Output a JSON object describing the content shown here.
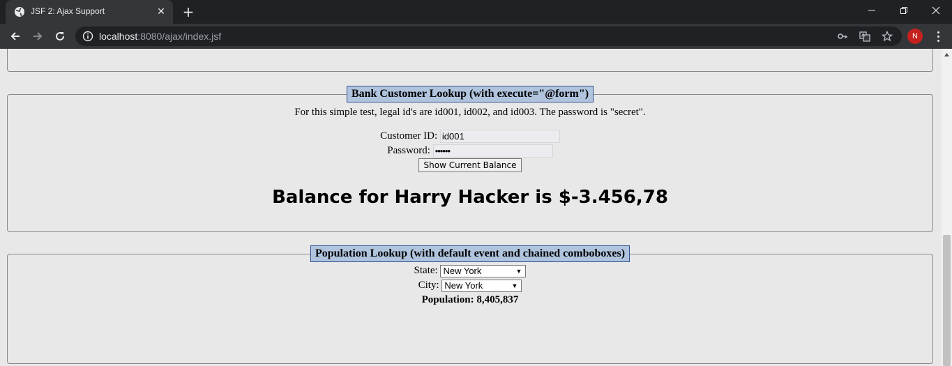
{
  "browser": {
    "tab_title": "JSF 2: Ajax Support",
    "url_host": "localhost",
    "url_rest": ":8080/ajax/index.jsf",
    "avatar_letter": "N"
  },
  "bank": {
    "legend": "Bank Customer Lookup (with execute=\"@form\")",
    "instructions": "For this simple test, legal id's are id001, id002, and id003. The password is \"secret\".",
    "customer_id_label": "Customer ID:",
    "customer_id_value": "id001",
    "password_label": "Password:",
    "password_value": "••••••",
    "button_label": "Show Current Balance",
    "balance_text": "Balance for Harry Hacker is $-3.456,78"
  },
  "population": {
    "legend": "Population Lookup (with default event and chained comboboxes)",
    "state_label": "State:",
    "state_value": "New York",
    "city_label": "City:",
    "city_value": "New York",
    "population_text": "Population: 8,405,837"
  },
  "colors": {
    "legend_bg": "#b0c4de",
    "page_bg": "#e8e8e8",
    "avatar_bg": "#c5221f"
  }
}
